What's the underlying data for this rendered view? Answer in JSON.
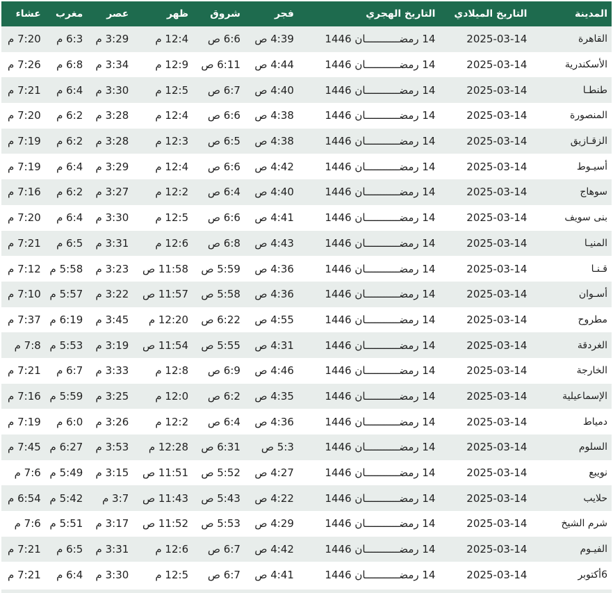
{
  "headers": {
    "city": "المدينة",
    "gregorian": "التاريخ الميلادي",
    "hijri": "التاريخ الهجري",
    "fajr": "فجر",
    "sunrise": "شروق",
    "dhuhr": "ظهر",
    "asr": "عصر",
    "maghrib": "مغرب",
    "isha": "عشاء"
  },
  "rows": [
    {
      "city": "القاهرة",
      "gregorian": "2025-03-14",
      "hijri": "14 رمضـــــــــــان 1446",
      "fajr": "4:39 ص",
      "sunrise": "6:6 ص",
      "dhuhr": "12:4 م",
      "asr": "3:29 م",
      "maghrib": "6:3 م",
      "isha": "7:20 م"
    },
    {
      "city": "الأسكندرية",
      "gregorian": "2025-03-14",
      "hijri": "14 رمضـــــــــــان 1446",
      "fajr": "4:44 ص",
      "sunrise": "6:11 ص",
      "dhuhr": "12:9 م",
      "asr": "3:34 م",
      "maghrib": "6:8 م",
      "isha": "7:26 م"
    },
    {
      "city": "طنطـا",
      "gregorian": "2025-03-14",
      "hijri": "14 رمضـــــــــــان 1446",
      "fajr": "4:40 ص",
      "sunrise": "6:7 ص",
      "dhuhr": "12:5 م",
      "asr": "3:30 م",
      "maghrib": "6:4 م",
      "isha": "7:21 م"
    },
    {
      "city": "المنصورة",
      "gregorian": "2025-03-14",
      "hijri": "14 رمضـــــــــــان 1446",
      "fajr": "4:38 ص",
      "sunrise": "6:6 ص",
      "dhuhr": "12:4 م",
      "asr": "3:28 م",
      "maghrib": "6:2 م",
      "isha": "7:20 م"
    },
    {
      "city": "الزقـازيق",
      "gregorian": "2025-03-14",
      "hijri": "14 رمضـــــــــــان 1446",
      "fajr": "4:38 ص",
      "sunrise": "6:5 ص",
      "dhuhr": "12:3 م",
      "asr": "3:28 م",
      "maghrib": "6:2 م",
      "isha": "7:19 م"
    },
    {
      "city": "أسيـوط",
      "gregorian": "2025-03-14",
      "hijri": "14 رمضـــــــــــان 1446",
      "fajr": "4:42 ص",
      "sunrise": "6:6 ص",
      "dhuhr": "12:4 م",
      "asr": "3:29 م",
      "maghrib": "6:4 م",
      "isha": "7:19 م"
    },
    {
      "city": "سوهاج",
      "gregorian": "2025-03-14",
      "hijri": "14 رمضـــــــــــان 1446",
      "fajr": "4:40 ص",
      "sunrise": "6:4 ص",
      "dhuhr": "12:2 م",
      "asr": "3:27 م",
      "maghrib": "6:2 م",
      "isha": "7:16 م"
    },
    {
      "city": "بنى سويف",
      "gregorian": "2025-03-14",
      "hijri": "14 رمضـــــــــــان 1446",
      "fajr": "4:41 ص",
      "sunrise": "6:6 ص",
      "dhuhr": "12:5 م",
      "asr": "3:30 م",
      "maghrib": "6:4 م",
      "isha": "7:20 م"
    },
    {
      "city": "المنيـا",
      "gregorian": "2025-03-14",
      "hijri": "14 رمضـــــــــــان 1446",
      "fajr": "4:43 ص",
      "sunrise": "6:8 ص",
      "dhuhr": "12:6 م",
      "asr": "3:31 م",
      "maghrib": "6:5 م",
      "isha": "7:21 م"
    },
    {
      "city": "قـنـا",
      "gregorian": "2025-03-14",
      "hijri": "14 رمضـــــــــــان 1446",
      "fajr": "4:36 ص",
      "sunrise": "5:59 ص",
      "dhuhr": "11:58 ص",
      "asr": "3:23 م",
      "maghrib": "5:58 م",
      "isha": "7:12 م"
    },
    {
      "city": "أسـوان",
      "gregorian": "2025-03-14",
      "hijri": "14 رمضـــــــــــان 1446",
      "fajr": "4:36 ص",
      "sunrise": "5:58 ص",
      "dhuhr": "11:57 ص",
      "asr": "3:22 م",
      "maghrib": "5:57 م",
      "isha": "7:10 م"
    },
    {
      "city": "مطروح",
      "gregorian": "2025-03-14",
      "hijri": "14 رمضـــــــــــان 1446",
      "fajr": "4:55 ص",
      "sunrise": "6:22 ص",
      "dhuhr": "12:20 م",
      "asr": "3:45 م",
      "maghrib": "6:19 م",
      "isha": "7:37 م"
    },
    {
      "city": "الغردقة",
      "gregorian": "2025-03-14",
      "hijri": "14 رمضـــــــــــان 1446",
      "fajr": "4:31 ص",
      "sunrise": "5:55 ص",
      "dhuhr": "11:54 ص",
      "asr": "3:19 م",
      "maghrib": "5:53 م",
      "isha": "7:8 م"
    },
    {
      "city": "الخارجة",
      "gregorian": "2025-03-14",
      "hijri": "14 رمضـــــــــــان 1446",
      "fajr": "4:46 ص",
      "sunrise": "6:9 ص",
      "dhuhr": "12:8 م",
      "asr": "3:33 م",
      "maghrib": "6:7 م",
      "isha": "7:21 م"
    },
    {
      "city": "الإسماعيلية",
      "gregorian": "2025-03-14",
      "hijri": "14 رمضـــــــــــان 1446",
      "fajr": "4:35 ص",
      "sunrise": "6:2 ص",
      "dhuhr": "12:0 م",
      "asr": "3:25 م",
      "maghrib": "5:59 م",
      "isha": "7:16 م"
    },
    {
      "city": "دمياط",
      "gregorian": "2025-03-14",
      "hijri": "14 رمضـــــــــــان 1446",
      "fajr": "4:36 ص",
      "sunrise": "6:4 ص",
      "dhuhr": "12:2 م",
      "asr": "3:26 م",
      "maghrib": "6:0 م",
      "isha": "7:19 م"
    },
    {
      "city": "السلوم",
      "gregorian": "2025-03-14",
      "hijri": "14 رمضـــــــــــان 1446",
      "fajr": "5:3 ص",
      "sunrise": "6:31 ص",
      "dhuhr": "12:28 م",
      "asr": "3:53 م",
      "maghrib": "6:27 م",
      "isha": "7:45 م"
    },
    {
      "city": "نويبع",
      "gregorian": "2025-03-14",
      "hijri": "14 رمضـــــــــــان 1446",
      "fajr": "4:27 ص",
      "sunrise": "5:52 ص",
      "dhuhr": "11:51 ص",
      "asr": "3:15 م",
      "maghrib": "5:49 م",
      "isha": "7:6 م"
    },
    {
      "city": "حلايب",
      "gregorian": "2025-03-14",
      "hijri": "14 رمضـــــــــــان 1446",
      "fajr": "4:22 ص",
      "sunrise": "5:43 ص",
      "dhuhr": "11:43 ص",
      "asr": "3:7 م",
      "maghrib": "5:42 م",
      "isha": "6:54 م"
    },
    {
      "city": "شرم الشيخ",
      "gregorian": "2025-03-14",
      "hijri": "14 رمضـــــــــــان 1446",
      "fajr": "4:29 ص",
      "sunrise": "5:53 ص",
      "dhuhr": "11:52 ص",
      "asr": "3:17 م",
      "maghrib": "5:51 م",
      "isha": "7:6 م"
    },
    {
      "city": "الفيـوم",
      "gregorian": "2025-03-14",
      "hijri": "14 رمضـــــــــــان 1446",
      "fajr": "4:42 ص",
      "sunrise": "6:7 ص",
      "dhuhr": "12:6 م",
      "asr": "3:31 م",
      "maghrib": "6:5 م",
      "isha": "7:21 م"
    },
    {
      "city": "6أكتوبر",
      "gregorian": "2025-03-14",
      "hijri": "14 رمضـــــــــــان 1446",
      "fajr": "4:41 ص",
      "sunrise": "6:7 ص",
      "dhuhr": "12:5 م",
      "asr": "3:30 م",
      "maghrib": "6:4 م",
      "isha": "7:21 م"
    }
  ],
  "colors": {
    "header_bg": "#1e6b4e",
    "row_alt_bg": "#e8edeb"
  }
}
